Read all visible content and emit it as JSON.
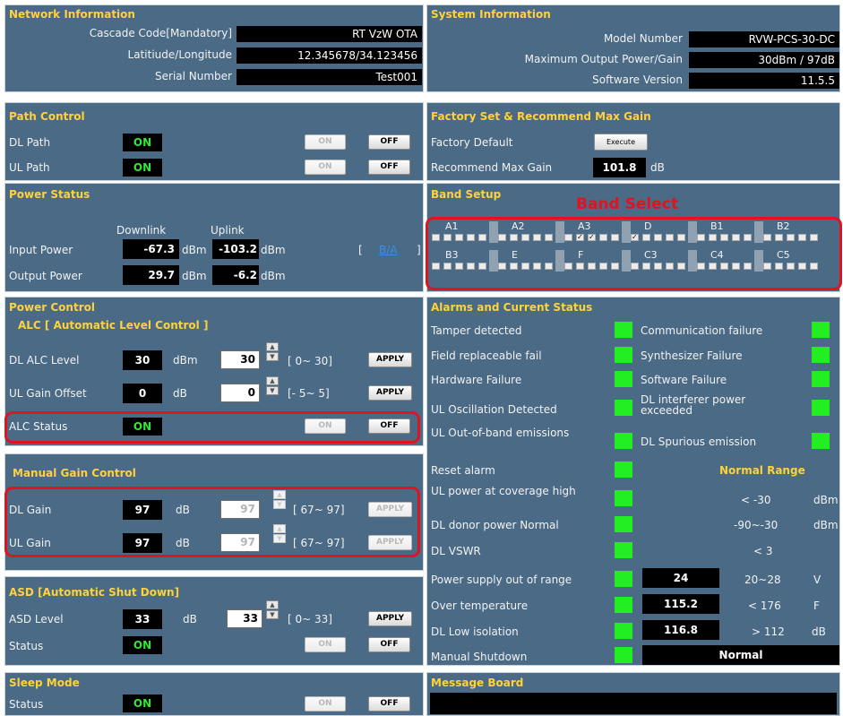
{
  "network": {
    "title": "Network Information",
    "cascade_label": "Cascade Code[Mandatory]",
    "cascade_value": "RT VzW OTA",
    "latlon_label": "Latitiude/Longitude",
    "latlon_value": "12.345678/34.123456",
    "serial_label": "Serial Number",
    "serial_value": "Test001"
  },
  "system": {
    "title": "System Information",
    "model_label": "Model Number",
    "model_value": "RVW-PCS-30-DC",
    "power_label": "Maximum Output Power/Gain",
    "power_value": "30dBm / 97dB",
    "sw_label": "Software Version",
    "sw_value": "11.5.5"
  },
  "path": {
    "title": "Path Control",
    "dl_label": "DL Path",
    "dl_status": "ON",
    "ul_label": "UL Path",
    "ul_status": "ON",
    "on_label": "ON",
    "off_label": "OFF"
  },
  "factory": {
    "title": "Factory Set & Recommend Max Gain",
    "default_label": "Factory Default",
    "execute_label": "Execute",
    "gain_label": "Recommend Max Gain",
    "gain_value": "101.8",
    "gain_unit": "dB"
  },
  "power_status": {
    "title": "Power Status",
    "downlink": "Downlink",
    "uplink": "Uplink",
    "input_label": "Input Power",
    "input_dl": "-67.3",
    "input_ul": "-103.2",
    "output_label": "Output Power",
    "output_dl": "29.7",
    "output_ul": "-6.2",
    "unit": "dBm",
    "bracket_open": "[",
    "link": "B/A",
    "bracket_close": "]"
  },
  "band_setup": {
    "title": "Band Setup",
    "select_label": "Band Select",
    "row1": [
      "A1",
      "A2",
      "A3",
      "D",
      "B1",
      "B2"
    ],
    "row2": [
      "B3",
      "E",
      "F",
      "C3",
      "C4",
      "C5"
    ],
    "checkmark": "✓"
  },
  "power_control": {
    "title": "Power Control",
    "alc_title": "ALC [ Automatic Level Control ]",
    "dl_alc_label": "DL ALC Level",
    "dl_alc_value": "30",
    "dl_alc_unit": "dBm",
    "dl_alc_input": "30",
    "dl_alc_range": "[ 0~ 30]",
    "ul_offset_label": "UL Gain Offset",
    "ul_offset_value": "0",
    "ul_offset_unit": "dB",
    "ul_offset_input": "0",
    "ul_offset_range": "[- 5~  5]",
    "apply": "APPLY",
    "alc_status_label": "ALC Status",
    "alc_status": "ON",
    "mgc_title": "Manual Gain Control",
    "dl_gain_label": "DL Gain",
    "dl_gain_value": "97",
    "dl_gain_input": "97",
    "dl_gain_range": "[ 67~ 97]",
    "ul_gain_label": "UL Gain",
    "ul_gain_value": "97",
    "ul_gain_input": "97",
    "ul_gain_range": "[ 67~ 97]",
    "gain_unit": "dB"
  },
  "asd": {
    "title": "ASD [Automatic Shut Down]",
    "level_label": "ASD Level",
    "level_value": "33",
    "level_unit": "dB",
    "level_input": "33",
    "level_range": "[ 0~ 33]",
    "status_label": "Status",
    "status": "ON"
  },
  "sleep": {
    "title": "Sleep Mode",
    "status_label": "Status",
    "status": "ON"
  },
  "alarms": {
    "title": "Alarms and Current Status",
    "tamper": "Tamper detected",
    "comm": "Communication failure",
    "field": "Field replaceable fail",
    "synth": "Synthesizer Failure",
    "hardware": "Hardware Failure",
    "software": "Software Failure",
    "ul_osc": "UL Oscillation Detected",
    "dl_interf": "DL interferer power exceeded",
    "ul_oob": "UL Out-of-band emissions",
    "dl_spur": "DL Spurious emission",
    "reset": "Reset alarm",
    "normal_range": "Normal Range",
    "ul_power": "UL power at coverage high",
    "ul_power_range": "< -30",
    "ul_power_unit": "dBm",
    "dl_donor": "DL donor power Normal",
    "dl_donor_range": "-90~-30",
    "dl_donor_unit": "dBm",
    "dl_vswr": "DL VSWR",
    "dl_vswr_range": "< 3",
    "psu": "Power supply out of range",
    "psu_value": "24",
    "psu_range": "20~28",
    "psu_unit": "V",
    "temp": "Over temperature",
    "temp_value": "115.2",
    "temp_range": "< 176",
    "temp_unit": "F",
    "dl_iso": "DL Low isolation",
    "dl_iso_value": "116.8",
    "dl_iso_range": "> 112",
    "dl_iso_unit": "dB",
    "manual": "Manual Shutdown",
    "manual_value": "Normal",
    "indicator_color": "#22ee22"
  },
  "message_board": {
    "title": "Message Board"
  },
  "colors": {
    "panel": "#4a6a86",
    "title": "#ffd23a",
    "on_text": "#38e438",
    "highlight": "#e0131f"
  }
}
